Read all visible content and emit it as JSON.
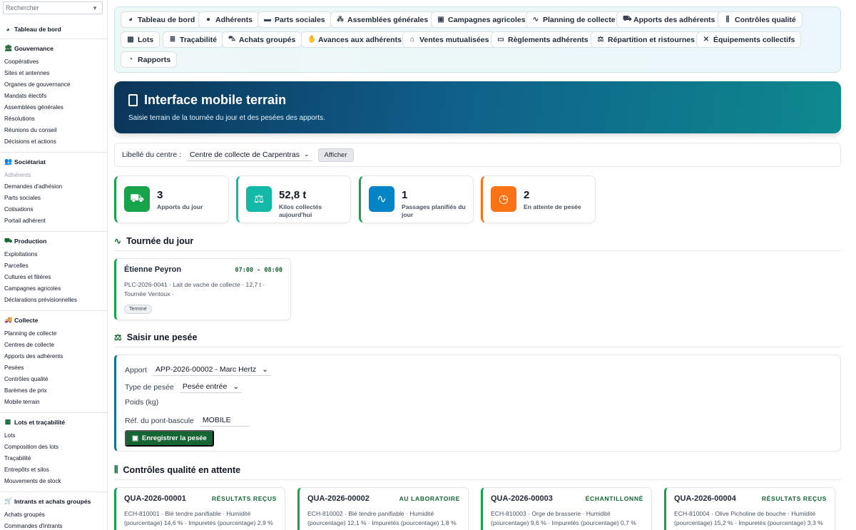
{
  "sidebar": {
    "search_placeholder": "Rechercher",
    "dashboard": "Tableau de bord",
    "groups": [
      {
        "title": "Gouvernance",
        "items": [
          "Coopératives",
          "Sites et antennes",
          "Organes de gouvernance",
          "Mandats électifs",
          "Assemblées générales",
          "Résolutions",
          "Réunions du conseil",
          "Décisions et actions"
        ]
      },
      {
        "title": "Sociétariat",
        "items": [
          "Adhérents",
          "Demandes d'adhésion",
          "Parts sociales",
          "Cotisations",
          "Portail adhérent"
        ]
      },
      {
        "title": "Production",
        "items": [
          "Exploitations",
          "Parcelles",
          "Cultures et filières",
          "Campagnes agricoles",
          "Déclarations prévisionnelles"
        ]
      },
      {
        "title": "Collecte",
        "items": [
          "Planning de collecte",
          "Centres de collecte",
          "Apports des adhérents",
          "Pesées",
          "Contrôles qualité",
          "Barèmes de prix",
          "Mobile terrain"
        ]
      },
      {
        "title": "Lots et traçabilité",
        "items": [
          "Lots",
          "Composition des lots",
          "Traçabilité",
          "Entrepôts et silos",
          "Mouvements de stock"
        ]
      },
      {
        "title": "Intrants et achats groupés",
        "items": [
          "Achats groupés",
          "Commandes d'intrants"
        ]
      }
    ]
  },
  "nav": [
    "Tableau de bord",
    "Adhérents",
    "Parts sociales",
    "Assemblées générales",
    "Campagnes agricoles",
    "Planning de collecte",
    "Apports des adhérents",
    "Contrôles qualité",
    "Lots",
    "Traçabilité",
    "Achats groupés",
    "Avances aux adhérents",
    "Ventes mutualisées",
    "Règlements adhérents",
    "Répartition et ristournes",
    "Équipements collectifs",
    "Rapports"
  ],
  "banner": {
    "title": "Interface mobile terrain",
    "subtitle": "Saisie terrain de la tournée du jour et des pesées des apports."
  },
  "filter": {
    "label": "Libellé du centre :",
    "value": "Centre de collecte de Carpentras",
    "button": "Afficher"
  },
  "kpis": [
    {
      "value": "3",
      "label": "Apports du jour",
      "color": "#16a34a"
    },
    {
      "value": "52,8 t",
      "label": "Kilos collectés aujourd'hui",
      "color": "#14b8a6"
    },
    {
      "value": "1",
      "label": "Passages planifiés du jour",
      "color": "#0284c7"
    },
    {
      "value": "2",
      "label": "En attente de pesée",
      "color": "#f97316"
    }
  ],
  "tournee": {
    "title": "Tournée du jour",
    "card": {
      "name": "Étienne Peyron",
      "time": "07:00 - 08:00",
      "details": "PLC-2026-0041 · Lait de vache de collecte · 12,7 t · Tournée Ventoux ·",
      "status": "Terminé"
    }
  },
  "pesee": {
    "title": "Saisir une pesée",
    "apport_label": "Apport",
    "apport_value": "APP-2026-00002 - Marc Hertz",
    "type_label": "Type de pesée",
    "type_value": "Pesée entrée",
    "poids_label": "Poids (kg)",
    "ref_label": "Réf. du pont-bascule",
    "ref_value": "MOBILE",
    "submit": "Enregistrer la pesée"
  },
  "qc": {
    "title": "Contrôles qualité en attente",
    "cards": [
      {
        "id": "QUA-2026-00001",
        "status": "RÉSULTATS REÇUS",
        "details": "ECH-810001 · Blé tendre panifiable · Humidité (pourcentage) 14,6 % · Impuretés (pourcentage) 2,9 %"
      },
      {
        "id": "QUA-2026-00002",
        "status": "AU LABORATOIRE",
        "details": "ECH-810002 · Blé tendre panifiable · Humidité (pourcentage) 12,1 % · Impuretés (pourcentage) 1,8 %"
      },
      {
        "id": "QUA-2026-00003",
        "status": "ÉCHANTILLONNÉ",
        "details": "ECH-810003 · Orge de brasserie · Humidité (pourcentage) 9,6 % · Impuretés (pourcentage) 0,7 %"
      },
      {
        "id": "QUA-2026-00004",
        "status": "RÉSULTATS REÇUS",
        "details": "ECH-810004 · Olive Picholine de bouche · Humidité (pourcentage) 15,2 % · Impuretés (pourcentage) 3,3 %"
      }
    ]
  }
}
